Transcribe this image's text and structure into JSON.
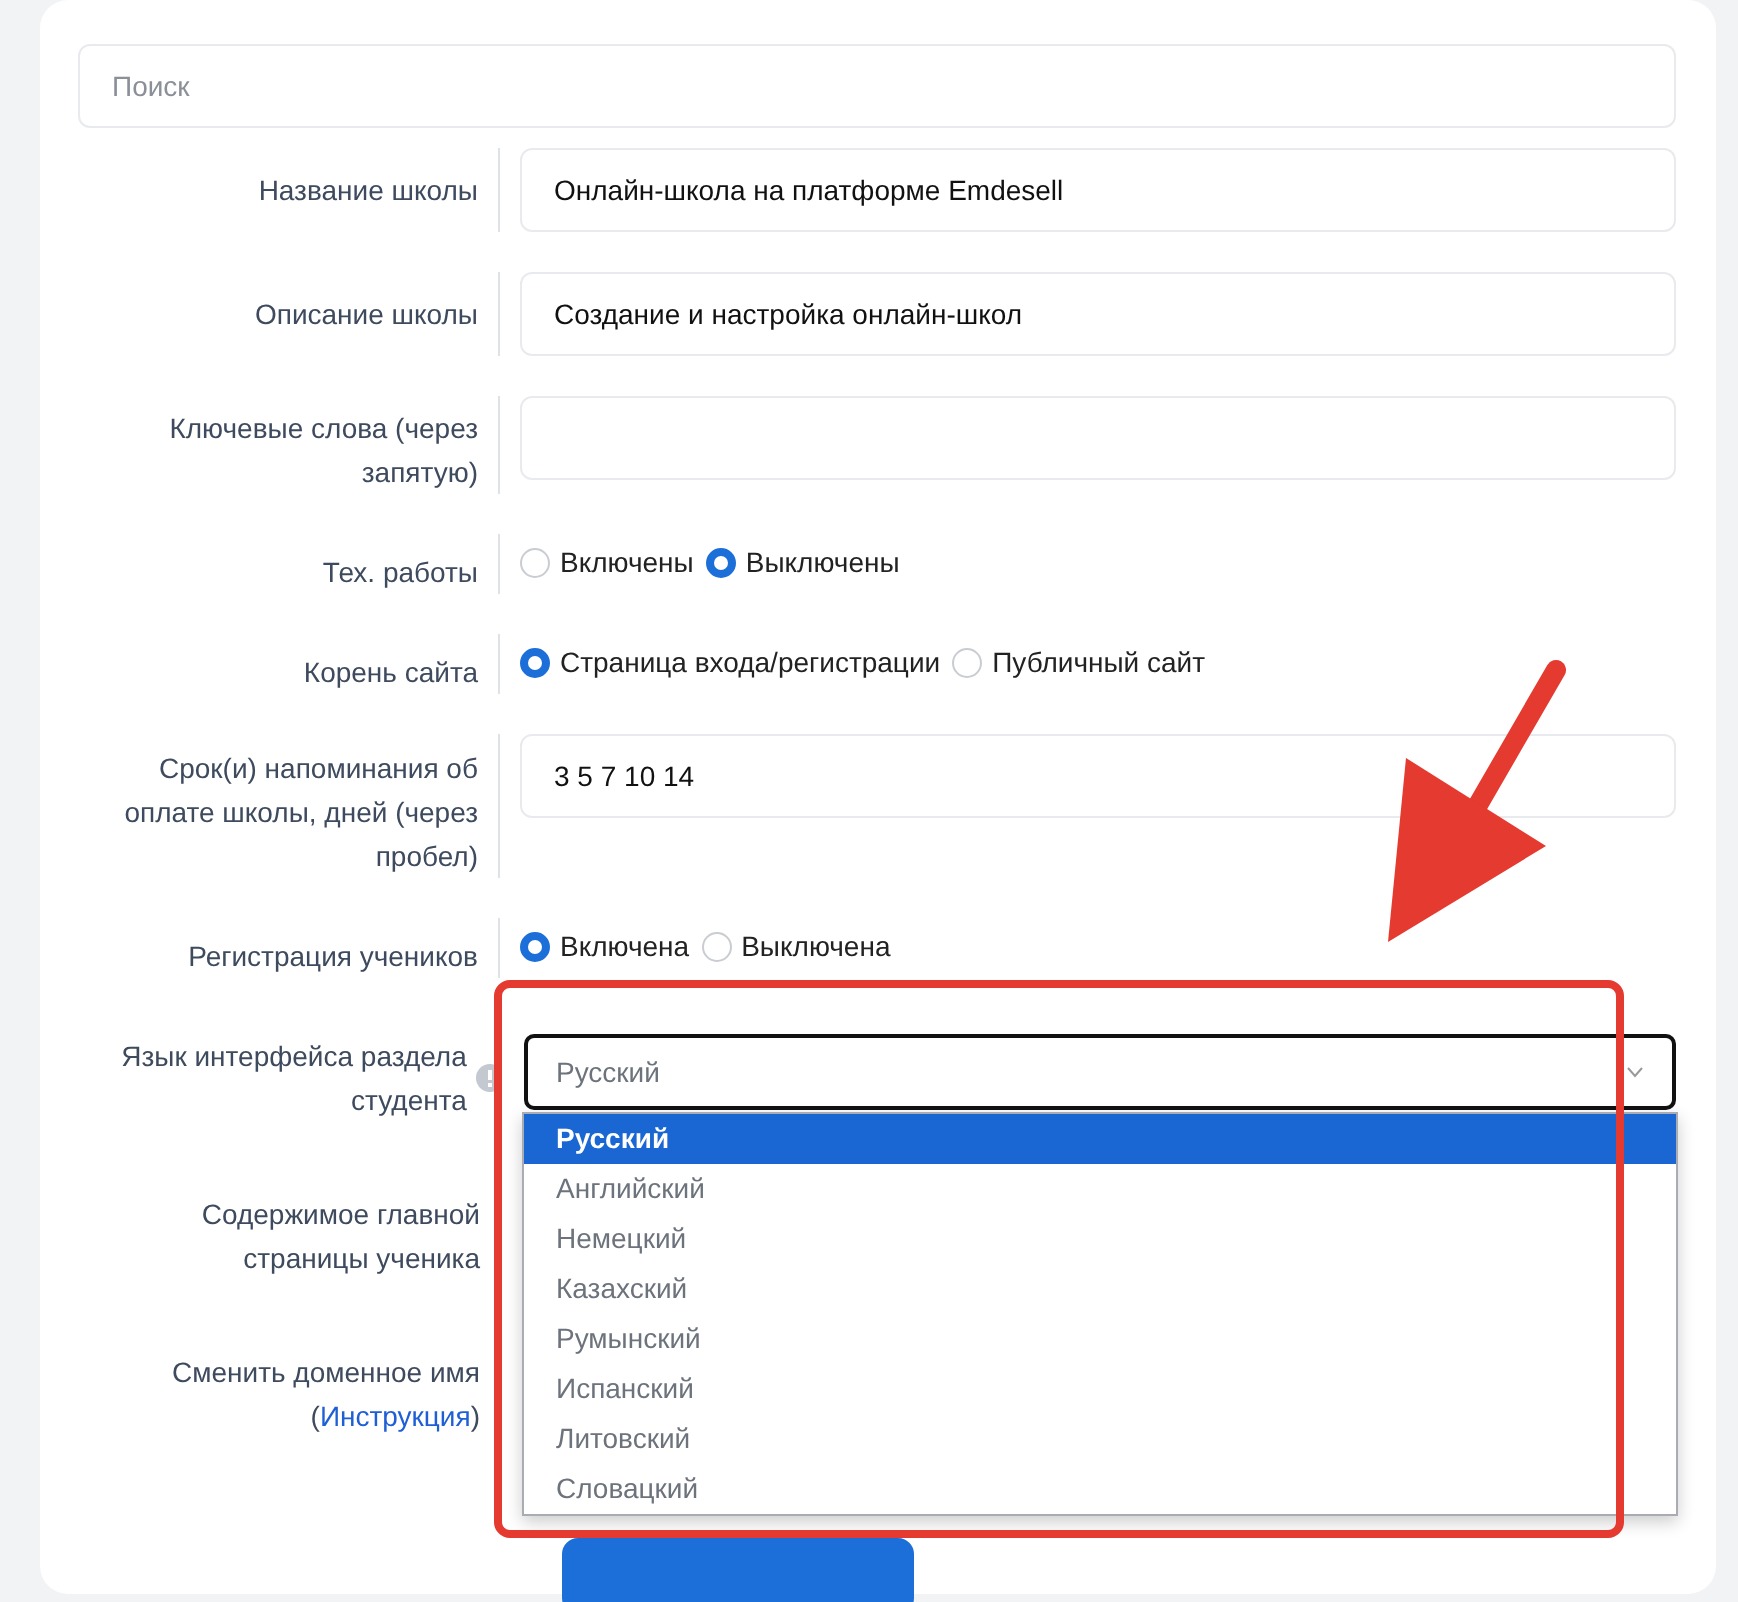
{
  "search": {
    "placeholder": "Поиск"
  },
  "fields": [
    {
      "kind": "text",
      "label": "Название школы",
      "value": "Онлайн-школа на платформе Emdesell"
    },
    {
      "kind": "text",
      "label": "Описание школы",
      "value": "Создание и настройка онлайн-школ"
    },
    {
      "kind": "text",
      "label": "Ключевые слова (через запятую)"
    },
    {
      "kind": "radio",
      "label": "Тех. работы",
      "options": [
        {
          "label": "Включены",
          "selected": false
        },
        {
          "label": "Выключены",
          "selected": true
        }
      ]
    },
    {
      "kind": "radio",
      "label": "Корень сайта",
      "options": [
        {
          "label": "Страница входа/регистрации",
          "selected": true
        },
        {
          "label": "Публичный сайт",
          "selected": false
        }
      ]
    },
    {
      "kind": "text",
      "label": "Срок(и) напоминания об оплате школы, дней (через пробел)",
      "value": "3 5 7 10 14"
    },
    {
      "kind": "radio",
      "label": "Регистрация учеников",
      "options": [
        {
          "label": "Включена",
          "selected": true
        },
        {
          "label": "Выключена",
          "selected": false
        }
      ]
    },
    {
      "kind": "select",
      "label": "Язык интерфейса раздела студента",
      "info": true,
      "value": "Русский",
      "expanded": true,
      "options": [
        {
          "label": "Русский",
          "selected": true
        },
        {
          "label": "Английский",
          "selected": false
        },
        {
          "label": "Немецкий",
          "selected": false
        },
        {
          "label": "Казахский",
          "selected": false
        },
        {
          "label": "Румынский",
          "selected": false
        },
        {
          "label": "Испанский",
          "selected": false
        },
        {
          "label": "Литовский",
          "selected": false
        },
        {
          "label": "Словацкий",
          "selected": false
        }
      ]
    },
    {
      "kind": "blank",
      "label": "Содержимое главной страницы ученика"
    },
    {
      "kind": "blank",
      "label": "Сменить доменное имя (",
      "link": "Инструкция",
      "label_end": ")"
    }
  ]
}
